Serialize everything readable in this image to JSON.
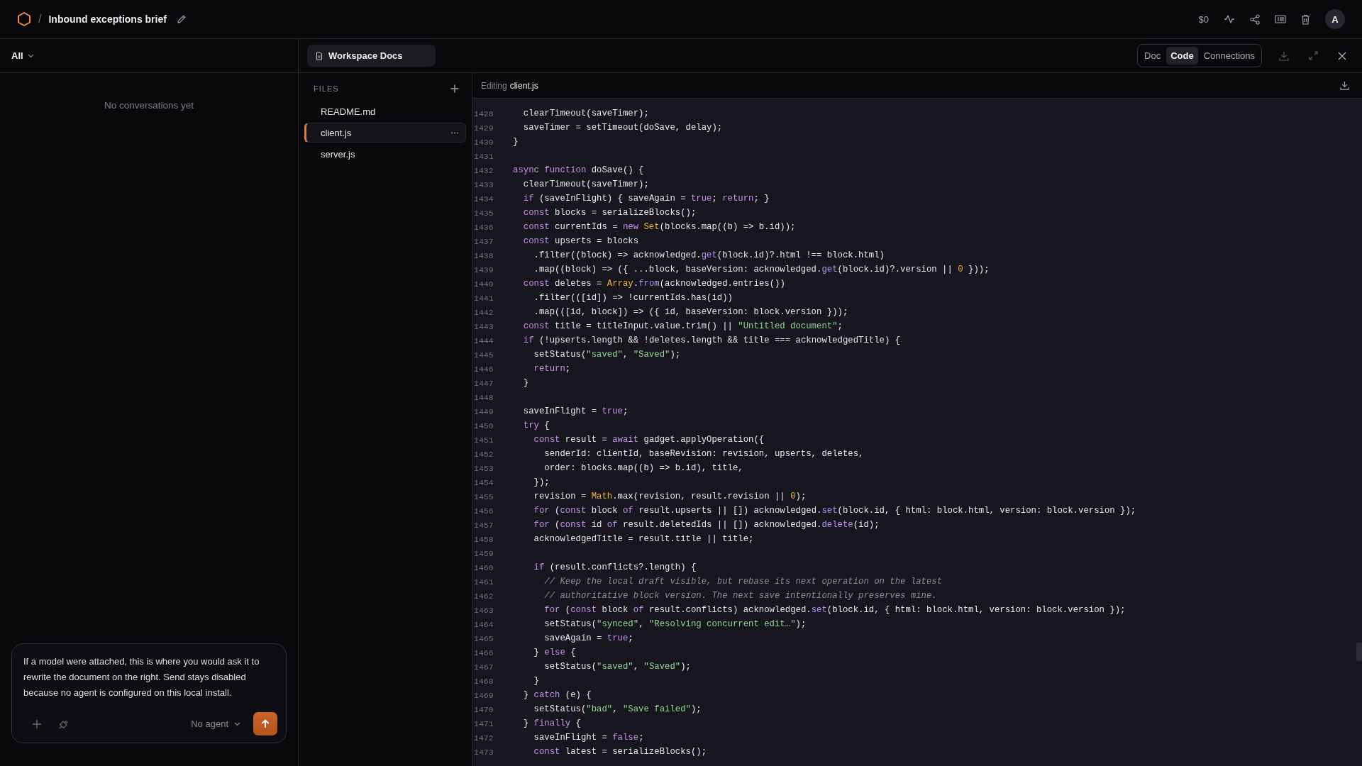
{
  "topbar": {
    "separator": "/",
    "title": "Inbound exceptions brief",
    "cost": "$0",
    "avatar": "A"
  },
  "sidebar": {
    "filter": "All",
    "empty_text": "No conversations yet",
    "composer": {
      "placeholder": "If a model were attached, this is where you would ask it to rewrite the document on the right. Send stays disabled because no agent is configured on this local install.",
      "agent": "No agent"
    }
  },
  "workspace": {
    "tab": "Workspace Docs",
    "views": [
      {
        "label": "Doc",
        "selected": false
      },
      {
        "label": "Code",
        "selected": true
      },
      {
        "label": "Connections",
        "selected": false
      }
    ]
  },
  "files": {
    "heading": "FILES",
    "items": [
      {
        "name": "README.md",
        "selected": false
      },
      {
        "name": "client.js",
        "selected": true
      },
      {
        "name": "server.js",
        "selected": false
      }
    ]
  },
  "editor": {
    "label": "Editing",
    "file": "client.js",
    "lines": [
      {
        "num": "1428",
        "parts": [
          {
            "kind": "plain",
            "text": "  clearTimeout(saveTimer);"
          }
        ]
      },
      {
        "num": "1429",
        "parts": [
          {
            "kind": "plain",
            "text": "  saveTimer = setTimeout(doSave, delay);"
          }
        ]
      },
      {
        "num": "1430",
        "parts": [
          {
            "kind": "plain",
            "text": "}"
          }
        ]
      },
      {
        "num": "1431"
      },
      {
        "num": "1432",
        "parts": [
          {
            "kind": "kw",
            "text": "async "
          },
          {
            "kind": "kw",
            "text": "function"
          },
          {
            "kind": "plain",
            "text": " doSave() {"
          }
        ]
      },
      {
        "num": "1433",
        "parts": [
          {
            "kind": "plain",
            "text": "  clearTimeout(saveTimer);"
          }
        ]
      },
      {
        "num": "1434",
        "parts": [
          {
            "kind": "kw",
            "text": "  if"
          },
          {
            "kind": "plain",
            "text": " (saveInFlight) { saveAgain = "
          },
          {
            "kind": "kw",
            "text": "true"
          },
          {
            "kind": "plain",
            "text": "; "
          },
          {
            "kind": "kw",
            "text": "return"
          },
          {
            "kind": "plain",
            "text": "; }"
          }
        ]
      },
      {
        "num": "1435",
        "parts": [
          {
            "kind": "kw",
            "text": "  const"
          },
          {
            "kind": "plain",
            "text": " blocks = serializeBlocks();"
          }
        ]
      },
      {
        "num": "1436",
        "parts": [
          {
            "kind": "kw",
            "text": "  const"
          },
          {
            "kind": "plain",
            "text": " currentIds = "
          },
          {
            "kind": "kw",
            "text": "new"
          },
          {
            "kind": "type",
            "text": " Set"
          },
          {
            "kind": "plain",
            "text": "(blocks.map((b) => b.id));"
          }
        ]
      },
      {
        "num": "1437",
        "parts": [
          {
            "kind": "kw",
            "text": "  const"
          },
          {
            "kind": "plain",
            "text": " upserts = blocks"
          }
        ]
      },
      {
        "num": "1438",
        "parts": [
          {
            "kind": "plain",
            "text": "    .filter((block) => acknowledged."
          },
          {
            "kind": "call",
            "text": "get"
          },
          {
            "kind": "plain",
            "text": "(block.id)?.html !== block.html)"
          }
        ]
      },
      {
        "num": "1439",
        "parts": [
          {
            "kind": "plain",
            "text": "    .map((block) => ({ ...block, baseVersion: acknowledged."
          },
          {
            "kind": "call",
            "text": "get"
          },
          {
            "kind": "plain",
            "text": "(block.id)?.version || "
          },
          {
            "kind": "num",
            "text": "0"
          },
          {
            "kind": "plain",
            "text": " }));"
          }
        ]
      },
      {
        "num": "1440",
        "parts": [
          {
            "kind": "kw",
            "text": "  const"
          },
          {
            "kind": "plain",
            "text": " deletes = "
          },
          {
            "kind": "type",
            "text": "Array"
          },
          {
            "kind": "plain",
            "text": "."
          },
          {
            "kind": "call",
            "text": "from"
          },
          {
            "kind": "plain",
            "text": "(acknowledged.entries())"
          }
        ]
      },
      {
        "num": "1441",
        "parts": [
          {
            "kind": "plain",
            "text": "    .filter(([id]) => !currentIds.has(id))"
          }
        ]
      },
      {
        "num": "1442",
        "parts": [
          {
            "kind": "plain",
            "text": "    .map(([id, block]) => ({ id, baseVersion: block.version }));"
          }
        ]
      },
      {
        "num": "1443",
        "parts": [
          {
            "kind": "kw",
            "text": "  const"
          },
          {
            "kind": "plain",
            "text": " title = titleInput.value.trim() || "
          },
          {
            "kind": "str",
            "text": "\"Untitled document\""
          },
          {
            "kind": "plain",
            "text": ";"
          }
        ]
      },
      {
        "num": "1444",
        "parts": [
          {
            "kind": "kw",
            "text": "  if"
          },
          {
            "kind": "plain",
            "text": " (!upserts.length && !deletes.length && title === acknowledgedTitle) {"
          }
        ]
      },
      {
        "num": "1445",
        "parts": [
          {
            "kind": "plain",
            "text": "    setStatus("
          },
          {
            "kind": "str",
            "text": "\"saved\""
          },
          {
            "kind": "plain",
            "text": ", "
          },
          {
            "kind": "str",
            "text": "\"Saved\""
          },
          {
            "kind": "plain",
            "text": ");"
          }
        ]
      },
      {
        "num": "1446",
        "parts": [
          {
            "kind": "kw",
            "text": "    return"
          },
          {
            "kind": "plain",
            "text": ";"
          }
        ]
      },
      {
        "num": "1447",
        "parts": [
          {
            "kind": "plain",
            "text": "  }"
          }
        ]
      },
      {
        "num": "1448"
      },
      {
        "num": "1449",
        "parts": [
          {
            "kind": "plain",
            "text": "  saveInFlight = "
          },
          {
            "kind": "kw",
            "text": "true"
          },
          {
            "kind": "plain",
            "text": ";"
          }
        ]
      },
      {
        "num": "1450",
        "parts": [
          {
            "kind": "kw",
            "text": "  try"
          },
          {
            "kind": "plain",
            "text": " {"
          }
        ]
      },
      {
        "num": "1451",
        "parts": [
          {
            "kind": "kw",
            "text": "    const"
          },
          {
            "kind": "plain",
            "text": " result = "
          },
          {
            "kind": "kw",
            "text": "await"
          },
          {
            "kind": "plain",
            "text": " gadget.applyOperation({"
          }
        ]
      },
      {
        "num": "1452",
        "parts": [
          {
            "kind": "plain",
            "text": "      senderId: clientId, baseRevision: revision, upserts, deletes,"
          }
        ]
      },
      {
        "num": "1453",
        "parts": [
          {
            "kind": "plain",
            "text": "      order: blocks.map((b) => b.id), title,"
          }
        ]
      },
      {
        "num": "1454",
        "parts": [
          {
            "kind": "plain",
            "text": "    });"
          }
        ]
      },
      {
        "num": "1455",
        "parts": [
          {
            "kind": "plain",
            "text": "    revision = "
          },
          {
            "kind": "type",
            "text": "Math"
          },
          {
            "kind": "plain",
            "text": ".max(revision, result.revision || "
          },
          {
            "kind": "num",
            "text": "0"
          },
          {
            "kind": "plain",
            "text": ");"
          }
        ]
      },
      {
        "num": "1456",
        "parts": [
          {
            "kind": "kw",
            "text": "    for"
          },
          {
            "kind": "plain",
            "text": " ("
          },
          {
            "kind": "kw",
            "text": "const"
          },
          {
            "kind": "plain",
            "text": " block "
          },
          {
            "kind": "kw",
            "text": "of"
          },
          {
            "kind": "plain",
            "text": " result.upserts || []) acknowledged."
          },
          {
            "kind": "call",
            "text": "set"
          },
          {
            "kind": "plain",
            "text": "(block.id, { html: block.html, version: block.version });"
          }
        ]
      },
      {
        "num": "1457",
        "parts": [
          {
            "kind": "kw",
            "text": "    for"
          },
          {
            "kind": "plain",
            "text": " ("
          },
          {
            "kind": "kw",
            "text": "const"
          },
          {
            "kind": "plain",
            "text": " id "
          },
          {
            "kind": "kw",
            "text": "of"
          },
          {
            "kind": "plain",
            "text": " result.deletedIds || []) acknowledged."
          },
          {
            "kind": "call",
            "text": "delete"
          },
          {
            "kind": "plain",
            "text": "(id);"
          }
        ]
      },
      {
        "num": "1458",
        "parts": [
          {
            "kind": "plain",
            "text": "    acknowledgedTitle = result.title || title;"
          }
        ]
      },
      {
        "num": "1459"
      },
      {
        "num": "1460",
        "parts": [
          {
            "kind": "kw",
            "text": "    if"
          },
          {
            "kind": "plain",
            "text": " (result.conflicts?.length) {"
          }
        ]
      },
      {
        "num": "1461",
        "parts": [
          {
            "kind": "comment",
            "text": "      // Keep the local draft visible, but rebase its next operation on the latest"
          }
        ]
      },
      {
        "num": "1462",
        "parts": [
          {
            "kind": "comment",
            "text": "      // authoritative block version. The next save intentionally preserves mine."
          }
        ]
      },
      {
        "num": "1463",
        "parts": [
          {
            "kind": "kw",
            "text": "      for"
          },
          {
            "kind": "plain",
            "text": " ("
          },
          {
            "kind": "kw",
            "text": "const"
          },
          {
            "kind": "plain",
            "text": " block "
          },
          {
            "kind": "kw",
            "text": "of"
          },
          {
            "kind": "plain",
            "text": " result.conflicts) acknowledged."
          },
          {
            "kind": "call",
            "text": "set"
          },
          {
            "kind": "plain",
            "text": "(block.id, { html: block.html, version: block.version });"
          }
        ]
      },
      {
        "num": "1464",
        "parts": [
          {
            "kind": "plain",
            "text": "      setStatus("
          },
          {
            "kind": "str",
            "text": "\"synced\""
          },
          {
            "kind": "plain",
            "text": ", "
          },
          {
            "kind": "str",
            "text": "\"Resolving concurrent edit…\""
          },
          {
            "kind": "plain",
            "text": ");"
          }
        ]
      },
      {
        "num": "1465",
        "parts": [
          {
            "kind": "plain",
            "text": "      saveAgain = "
          },
          {
            "kind": "kw",
            "text": "true"
          },
          {
            "kind": "plain",
            "text": ";"
          }
        ]
      },
      {
        "num": "1466",
        "parts": [
          {
            "kind": "plain",
            "text": "    } "
          },
          {
            "kind": "kw",
            "text": "else"
          },
          {
            "kind": "plain",
            "text": " {"
          }
        ]
      },
      {
        "num": "1467",
        "parts": [
          {
            "kind": "plain",
            "text": "      setStatus("
          },
          {
            "kind": "str",
            "text": "\"saved\""
          },
          {
            "kind": "plain",
            "text": ", "
          },
          {
            "kind": "str",
            "text": "\"Saved\""
          },
          {
            "kind": "plain",
            "text": ");"
          }
        ]
      },
      {
        "num": "1468",
        "parts": [
          {
            "kind": "plain",
            "text": "    }"
          }
        ]
      },
      {
        "num": "1469",
        "parts": [
          {
            "kind": "plain",
            "text": "  } "
          },
          {
            "kind": "kw",
            "text": "catch"
          },
          {
            "kind": "plain",
            "text": " (e) {"
          }
        ]
      },
      {
        "num": "1470",
        "parts": [
          {
            "kind": "plain",
            "text": "    setStatus("
          },
          {
            "kind": "str",
            "text": "\"bad\""
          },
          {
            "kind": "plain",
            "text": ", "
          },
          {
            "kind": "str",
            "text": "\"Save failed\""
          },
          {
            "kind": "plain",
            "text": ");"
          }
        ]
      },
      {
        "num": "1471",
        "parts": [
          {
            "kind": "plain",
            "text": "  } "
          },
          {
            "kind": "kw",
            "text": "finally"
          },
          {
            "kind": "plain",
            "text": " {"
          }
        ]
      },
      {
        "num": "1472",
        "parts": [
          {
            "kind": "plain",
            "text": "    saveInFlight = "
          },
          {
            "kind": "kw",
            "text": "false"
          },
          {
            "kind": "plain",
            "text": ";"
          }
        ]
      },
      {
        "num": "1473",
        "parts": [
          {
            "kind": "kw",
            "text": "    const"
          },
          {
            "kind": "plain",
            "text": " latest = serializeBlocks();"
          }
        ]
      }
    ]
  }
}
